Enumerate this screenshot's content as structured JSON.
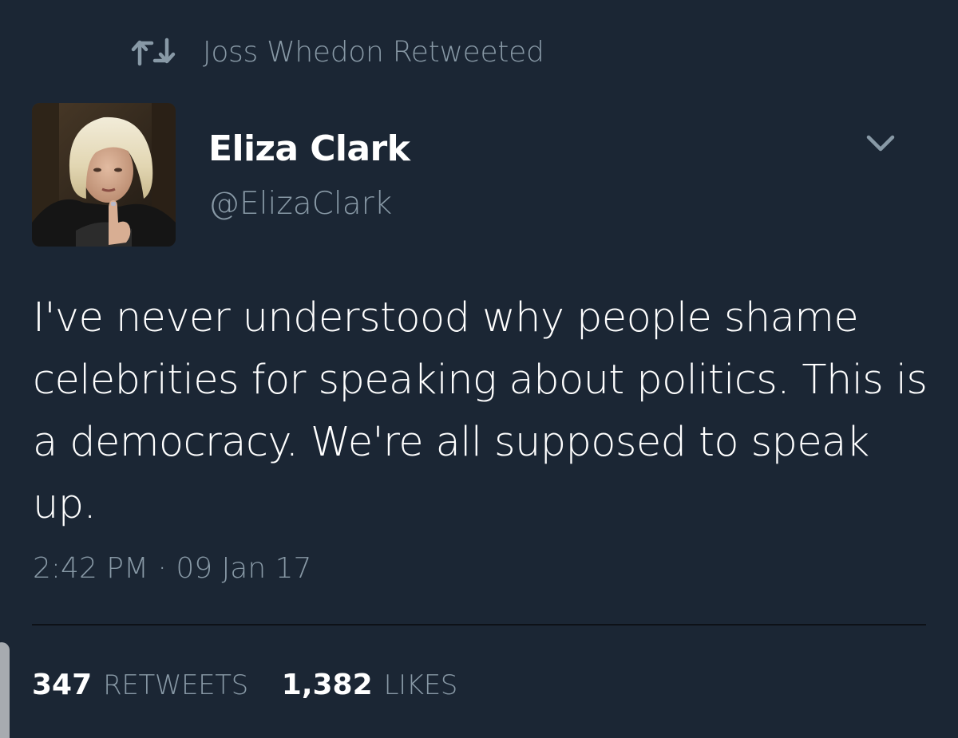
{
  "retweet_context": {
    "icon": "retweet-icon",
    "text": "Joss Whedon Retweeted"
  },
  "author": {
    "display_name": "Eliza Clark",
    "handle": "@ElizaClark",
    "avatar": "profile-photo"
  },
  "menu": {
    "icon": "chevron-down-icon"
  },
  "tweet": {
    "text": "I've never understood why people shame celebrities for speaking about politics. This is a democracy. We're all supposed to speak up.",
    "timestamp": "2:42 PM · 09 Jan 17"
  },
  "stats": {
    "retweets_count": "347",
    "retweets_label": "RETWEETS",
    "likes_count": "1,382",
    "likes_label": "LIKES"
  },
  "colors": {
    "background": "#1b2634",
    "secondary_text": "#8899a6",
    "primary_text": "#ffffff"
  }
}
